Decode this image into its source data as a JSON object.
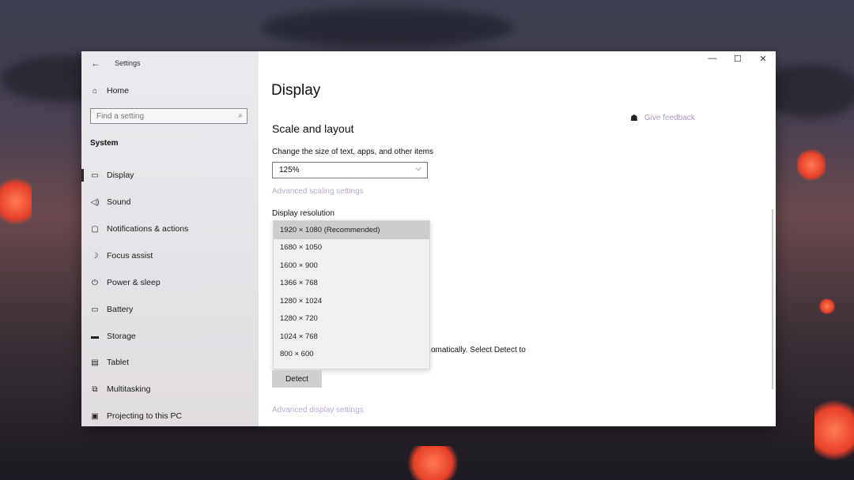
{
  "window": {
    "app_title": "Settings",
    "controls": {
      "minimize": "—",
      "maximize": "☐",
      "close": "✕"
    }
  },
  "sidebar": {
    "home": "Home",
    "search_placeholder": "Find a setting",
    "section": "System",
    "items": [
      {
        "label": "Display",
        "icon": "monitor-icon",
        "glyph": "▭"
      },
      {
        "label": "Sound",
        "icon": "speaker-icon",
        "glyph": "🔈"
      },
      {
        "label": "Notifications & actions",
        "icon": "notification-icon",
        "glyph": "▢"
      },
      {
        "label": "Focus assist",
        "icon": "moon-icon",
        "glyph": "☽"
      },
      {
        "label": "Power & sleep",
        "icon": "power-icon",
        "glyph": "⏻"
      },
      {
        "label": "Battery",
        "icon": "battery-icon",
        "glyph": "▭"
      },
      {
        "label": "Storage",
        "icon": "storage-icon",
        "glyph": "▬"
      },
      {
        "label": "Tablet",
        "icon": "tablet-icon",
        "glyph": "▤"
      },
      {
        "label": "Multitasking",
        "icon": "multitasking-icon",
        "glyph": "⧉"
      },
      {
        "label": "Projecting to this PC",
        "icon": "projector-icon",
        "glyph": "▣"
      }
    ]
  },
  "main": {
    "title": "Display",
    "feedback": "Give feedback",
    "section_title": "Scale and layout",
    "scale_label": "Change the size of text, apps, and other items",
    "scale_value": "125%",
    "advanced_scaling_link": "Advanced scaling settings",
    "resolution_label": "Display resolution",
    "resolution_options": [
      "1920 × 1080 (Recommended)",
      "1680 × 1050",
      "1600 × 900",
      "1366 × 768",
      "1280 × 1024",
      "1280 × 720",
      "1024 × 768",
      "800 × 600"
    ],
    "partial_text": "omatically. Select Detect to",
    "detect_button": "Detect",
    "advanced_display_link": "Advanced display settings"
  }
}
